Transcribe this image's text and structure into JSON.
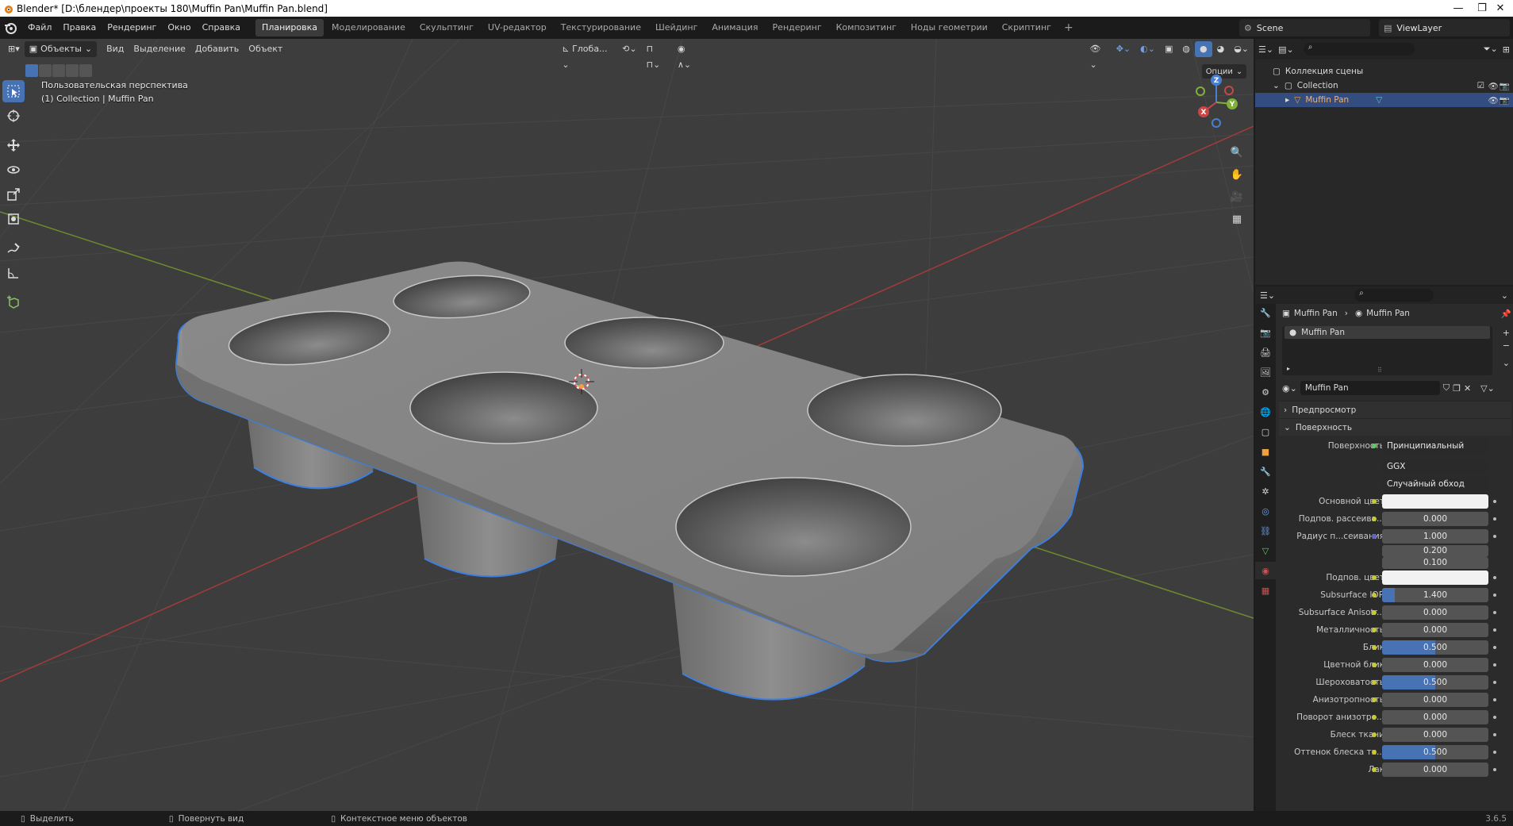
{
  "window": {
    "title": "Blender* [D:\\блендер\\проекты 180\\Muffin Pan\\Muffin Pan.blend]",
    "minimize": "—",
    "restore": "❐",
    "close": "✕"
  },
  "menu": [
    "Файл",
    "Правка",
    "Рендеринг",
    "Окно",
    "Справка"
  ],
  "workspaces": [
    "Планировка",
    "Моделирование",
    "Скульптинг",
    "UV-редактор",
    "Текстурирование",
    "Шейдинг",
    "Анимация",
    "Рендеринг",
    "Композитинг",
    "Ноды геометрии",
    "Скриптинг"
  ],
  "workspace_add": "+",
  "scene": "Scene",
  "view_layer": "ViewLayer",
  "viewport": {
    "mode": "Объекты",
    "menus": [
      "Вид",
      "Выделение",
      "Добавить",
      "Объект"
    ],
    "transform_orientation": "Глоба...",
    "options": "Опции",
    "info_line1": "Пользовательская перспектива",
    "info_line2": "(1) Collection | Muffin Pan",
    "gizmo": {
      "x": "X",
      "y": "Y",
      "z": "Z"
    }
  },
  "outliner": {
    "root": "Коллекция сцены",
    "collection": "Collection",
    "object": "Muffin Pan"
  },
  "properties": {
    "breadcrumb_object": "Muffin Pan",
    "breadcrumb_material": "Muffin Pan",
    "slot_name": "Muffin Pan",
    "material_name": "Muffin Pan",
    "panel_preview": "Предпросмотр",
    "panel_surface": "Поверхность",
    "surface_label": "Поверхность",
    "surface_shader": "Принципиальный BSDF",
    "distribution": "GGX",
    "subsurface_method": "Случайный обход",
    "rows": [
      {
        "label": "Основной цвет",
        "value": "",
        "type": "color"
      },
      {
        "label": "Подпов. рассеива...",
        "value": "0.000",
        "fill": 0
      },
      {
        "label": "Радиус п...сеивания",
        "value": "1.000",
        "fill": 0,
        "dot": "blue"
      },
      {
        "label": "",
        "value": "0.200",
        "fill": 0,
        "sub": true
      },
      {
        "label": "",
        "value": "0.100",
        "fill": 0,
        "sub": true
      },
      {
        "label": "Подпов. цвет",
        "value": "",
        "type": "color"
      },
      {
        "label": "Subsurface IOR",
        "value": "1.400",
        "fill": 0.12
      },
      {
        "label": "Subsurface Anisotr...",
        "value": "0.000",
        "fill": 0
      },
      {
        "label": "Металличность",
        "value": "0.000",
        "fill": 0
      },
      {
        "label": "Блик",
        "value": "0.500",
        "fill": 0.5
      },
      {
        "label": "Цветной блик",
        "value": "0.000",
        "fill": 0
      },
      {
        "label": "Шероховатость",
        "value": "0.500",
        "fill": 0.5
      },
      {
        "label": "Анизотропность",
        "value": "0.000",
        "fill": 0
      },
      {
        "label": "Поворот анизотро...",
        "value": "0.000",
        "fill": 0
      },
      {
        "label": "Блеск ткани",
        "value": "0.000",
        "fill": 0
      },
      {
        "label": "Оттенок блеска тк...",
        "value": "0.500",
        "fill": 0.5
      },
      {
        "label": "Лак",
        "value": "0.000",
        "fill": 0
      }
    ]
  },
  "status": {
    "select": "Выделить",
    "rotate": "Повернуть вид",
    "context": "Контекстное меню объектов",
    "version": "3.6.5"
  },
  "colors": {
    "accent": "#4772b3",
    "selection_outline": "#3d7fe0",
    "viewport_bg": "#3d3d3d",
    "axis_x": "#c74747",
    "axis_y": "#7fb03a"
  }
}
